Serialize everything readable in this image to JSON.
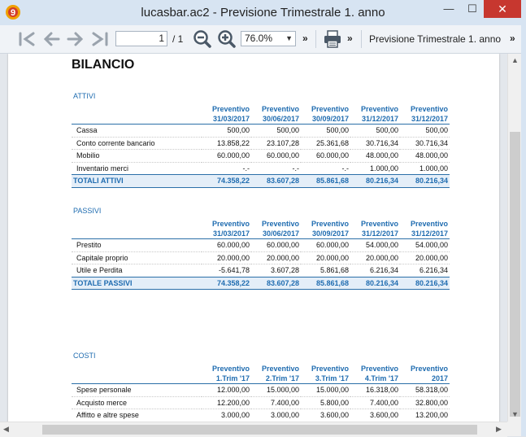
{
  "window": {
    "title": "lucasbar.ac2 - Previsione Trimestrale 1. anno",
    "minimize": "—",
    "maximize": "☐",
    "close": "✕",
    "app_icon": "9"
  },
  "toolbar": {
    "page_value": "1",
    "page_total": "/ 1",
    "zoom": "76.0%",
    "more1": "»",
    "more2": "»",
    "more3": "»",
    "report_name": "Previsione Trimestrale 1. anno",
    "icons": [
      "first-page-icon",
      "prev-page-icon",
      "next-page-icon",
      "last-page-icon",
      "zoom-out-icon",
      "zoom-in-icon",
      "print-icon"
    ]
  },
  "report": {
    "heading": "BILANCIO",
    "attivi": {
      "label": "ATTIVI",
      "headers": [
        [
          "Preventivo",
          "31/03/2017"
        ],
        [
          "Preventivo",
          "30/06/2017"
        ],
        [
          "Preventivo",
          "30/09/2017"
        ],
        [
          "Preventivo",
          "31/12/2017"
        ],
        [
          "Preventivo",
          "31/12/2017"
        ]
      ],
      "rows": [
        {
          "label": "Cassa",
          "values": [
            "500,00",
            "500,00",
            "500,00",
            "500,00",
            "500,00"
          ]
        },
        {
          "label": "Conto corrente bancario",
          "values": [
            "13.858,22",
            "23.107,28",
            "25.361,68",
            "30.716,34",
            "30.716,34"
          ]
        },
        {
          "label": "Mobilio",
          "values": [
            "60.000,00",
            "60.000,00",
            "60.000,00",
            "48.000,00",
            "48.000,00"
          ]
        },
        {
          "label": "Inventario merci",
          "values": [
            "-.-",
            "-.-",
            "-.-",
            "1.000,00",
            "1.000,00"
          ]
        }
      ],
      "total": {
        "label": "TOTALI ATTIVI",
        "values": [
          "74.358,22",
          "83.607,28",
          "85.861,68",
          "80.216,34",
          "80.216,34"
        ]
      }
    },
    "passivi": {
      "label": "PASSIVI",
      "headers": [
        [
          "Preventivo",
          "31/03/2017"
        ],
        [
          "Preventivo",
          "30/06/2017"
        ],
        [
          "Preventivo",
          "30/09/2017"
        ],
        [
          "Preventivo",
          "31/12/2017"
        ],
        [
          "Preventivo",
          "31/12/2017"
        ]
      ],
      "rows": [
        {
          "label": "Prestito",
          "values": [
            "60.000,00",
            "60.000,00",
            "60.000,00",
            "54.000,00",
            "54.000,00"
          ]
        },
        {
          "label": "Capitale proprio",
          "values": [
            "20.000,00",
            "20.000,00",
            "20.000,00",
            "20.000,00",
            "20.000,00"
          ]
        },
        {
          "label": "Utile e Perdita",
          "values": [
            "-5.641,78",
            "3.607,28",
            "5.861,68",
            "6.216,34",
            "6.216,34"
          ]
        }
      ],
      "total": {
        "label": "TOTALE PASSIVI",
        "values": [
          "74.358,22",
          "83.607,28",
          "85.861,68",
          "80.216,34",
          "80.216,34"
        ]
      }
    },
    "costi": {
      "label": "COSTI",
      "headers": [
        [
          "Preventivo",
          "1.Trim '17"
        ],
        [
          "Preventivo",
          "2.Trim '17"
        ],
        [
          "Preventivo",
          "3.Trim '17"
        ],
        [
          "Preventivo",
          "4.Trim '17"
        ],
        [
          "Preventivo",
          "2017"
        ]
      ],
      "rows": [
        {
          "label": "Spese personale",
          "values": [
            "12.000,00",
            "15.000,00",
            "15.000,00",
            "16.318,00",
            "58.318,00"
          ]
        },
        {
          "label": "Acquisto merce",
          "values": [
            "12.200,00",
            "7.400,00",
            "5.800,00",
            "7.400,00",
            "32.800,00"
          ]
        },
        {
          "label": "Affitto e altre spese",
          "values": [
            "3.000,00",
            "3.000,00",
            "3.600,00",
            "3.600,00",
            "13.200,00"
          ]
        }
      ]
    }
  }
}
